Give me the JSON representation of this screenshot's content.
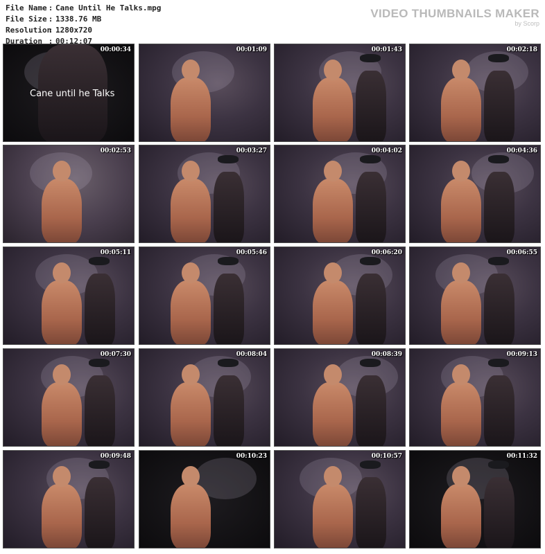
{
  "file_info": {
    "name_label": "File Name",
    "name_value": "Cane Until He Talks.mpg",
    "size_label": "File Size",
    "size_value": "1338.76 MB",
    "resolution_label": "Resolution",
    "resolution_value": "1280x720",
    "duration_label": "Duration",
    "duration_value": "00:12:07",
    "separator": ":"
  },
  "brand": {
    "title": "VIDEO THUMBNAILS MAKER",
    "subtitle": "by Scorp"
  },
  "thumbnails": [
    {
      "timestamp": "00:00:34",
      "caption": "Cane until he Talks"
    },
    {
      "timestamp": "00:01:09"
    },
    {
      "timestamp": "00:01:43"
    },
    {
      "timestamp": "00:02:18"
    },
    {
      "timestamp": "00:02:53"
    },
    {
      "timestamp": "00:03:27"
    },
    {
      "timestamp": "00:04:02"
    },
    {
      "timestamp": "00:04:36"
    },
    {
      "timestamp": "00:05:11"
    },
    {
      "timestamp": "00:05:46"
    },
    {
      "timestamp": "00:06:20"
    },
    {
      "timestamp": "00:06:55"
    },
    {
      "timestamp": "00:07:30"
    },
    {
      "timestamp": "00:08:04"
    },
    {
      "timestamp": "00:08:39"
    },
    {
      "timestamp": "00:09:13"
    },
    {
      "timestamp": "00:09:48"
    },
    {
      "timestamp": "00:10:23"
    },
    {
      "timestamp": "00:10:57"
    },
    {
      "timestamp": "00:11:32"
    }
  ]
}
